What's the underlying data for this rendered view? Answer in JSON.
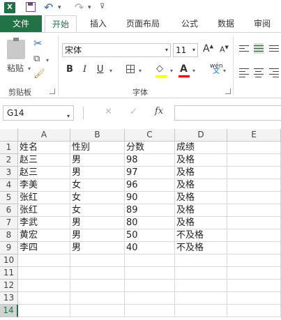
{
  "qat": {
    "app_icon": "X",
    "save_icon": "save-icon",
    "undo_icon": "undo-icon",
    "redo_icon": "redo-icon"
  },
  "tabs": [
    "文件",
    "开始",
    "插入",
    "页面布局",
    "公式",
    "数据",
    "审阅"
  ],
  "ribbon": {
    "clipboard": {
      "paste_label": "粘贴",
      "group_label": "剪贴板"
    },
    "font": {
      "name": "宋体",
      "size": "11",
      "grow": "A",
      "shrink": "A",
      "bold": "B",
      "italic": "I",
      "underline": "U",
      "color_letter": "A",
      "wen_top": "wén",
      "wen_bottom": "文",
      "group_label": "字体"
    }
  },
  "formula_bar": {
    "name_box": "G14",
    "fx": "fx",
    "cancel": "✕",
    "enter": "✓",
    "value": ""
  },
  "sheet": {
    "columns": [
      "A",
      "B",
      "C",
      "D",
      "E"
    ],
    "rows": [
      "1",
      "2",
      "3",
      "4",
      "5",
      "6",
      "7",
      "8",
      "9",
      "10",
      "11",
      "12",
      "13",
      "14"
    ],
    "selected_row": "14",
    "data": [
      [
        "姓名",
        "性别",
        "分数",
        "成绩"
      ],
      [
        "赵三",
        "男",
        "98",
        "及格"
      ],
      [
        "赵三",
        "男",
        "97",
        "及格"
      ],
      [
        "李美",
        "女",
        "96",
        "及格"
      ],
      [
        "张红",
        "女",
        "90",
        "及格"
      ],
      [
        "张红",
        "女",
        "89",
        "及格"
      ],
      [
        "李武",
        "男",
        "80",
        "及格"
      ],
      [
        "黄宏",
        "男",
        "50",
        "不及格"
      ],
      [
        "李四",
        "男",
        "40",
        "不及格"
      ]
    ]
  },
  "colors": {
    "accent": "#217346",
    "fill_color": "#ffff00",
    "font_color": "#ff0000"
  }
}
